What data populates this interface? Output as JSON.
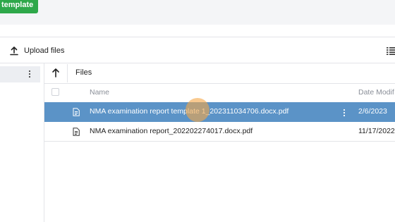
{
  "toolbar": {
    "template_button_label": "template",
    "upload_label": "Upload files",
    "icons": {
      "upload": "upload-icon",
      "view": "list-view-icon"
    }
  },
  "breadcrumb": {
    "current_folder": "Files",
    "icons": {
      "up": "arrow-up-icon"
    }
  },
  "table": {
    "columns": [
      "Name",
      "Date Modif"
    ],
    "rows": [
      {
        "name": "NMA examination report template 1_202311034706.docx.pdf",
        "date": "2/6/2023",
        "selected": true
      },
      {
        "name": "NMA examination report_202202274017.docx.pdf",
        "date": "11/17/2022",
        "selected": false
      }
    ]
  },
  "colors": {
    "accent_green": "#2ea84a",
    "selected_row": "#5b93c7",
    "cursor_highlight": "#f5a646"
  }
}
